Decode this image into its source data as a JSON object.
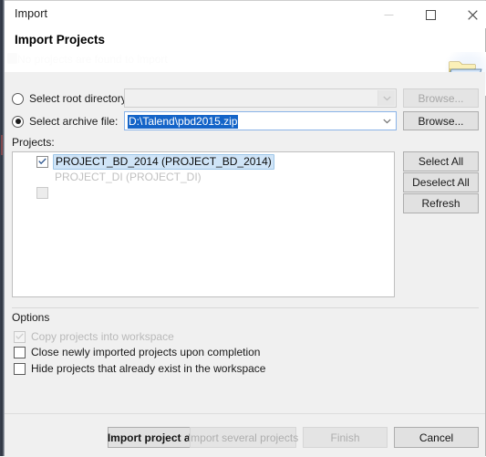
{
  "window": {
    "title": "Import",
    "controls": {
      "minimize": "minimize-icon",
      "maximize": "maximize-icon",
      "close": "close-icon"
    }
  },
  "header": {
    "title": "Import Projects",
    "subtitle": "No projects are found to import",
    "icon": "open-folder-icon"
  },
  "source": {
    "root_directory": {
      "label": "Select root directory:",
      "selected": false,
      "value": "",
      "placeholder": "",
      "browse_label": "Browse...",
      "browse_enabled": false,
      "combo_enabled": false
    },
    "archive_file": {
      "label": "Select archive file:",
      "selected": true,
      "value": "D:\\Talend\\pbd2015.zip",
      "browse_label": "Browse...",
      "browse_enabled": true,
      "combo_enabled": true,
      "selection_color": "#1464c8"
    }
  },
  "projects": {
    "label": "Projects:",
    "items": [
      {
        "text": "PROJECT_BD_2014 (PROJECT_BD_2014)",
        "checked": true,
        "enabled": true,
        "selected": true
      },
      {
        "text": "PROJECT_DI (PROJECT_DI)",
        "checked": false,
        "enabled": false,
        "selected": false
      }
    ],
    "buttons": [
      {
        "label": "Select All",
        "enabled": true
      },
      {
        "label": "Deselect All",
        "enabled": true
      },
      {
        "label": "Refresh",
        "enabled": true
      }
    ]
  },
  "options": {
    "title": "Options",
    "items": [
      {
        "label": "Copy projects into workspace",
        "checked": true,
        "enabled": false
      },
      {
        "label": "Close newly imported projects upon completion",
        "checked": false,
        "enabled": true
      },
      {
        "label": "Hide projects that already exist in the workspace",
        "checked": false,
        "enabled": true
      }
    ]
  },
  "footer": {
    "buttons": [
      {
        "label": "Import project as",
        "enabled": true
      },
      {
        "label": "Import several projects",
        "enabled": false
      },
      {
        "label": "Finish",
        "enabled": false
      },
      {
        "label": "Cancel",
        "enabled": true
      }
    ]
  },
  "colors": {
    "selection_blue": "#1464c8",
    "list_selection": "#cfe4f7",
    "dialog_bg": "#f0f0f0"
  }
}
